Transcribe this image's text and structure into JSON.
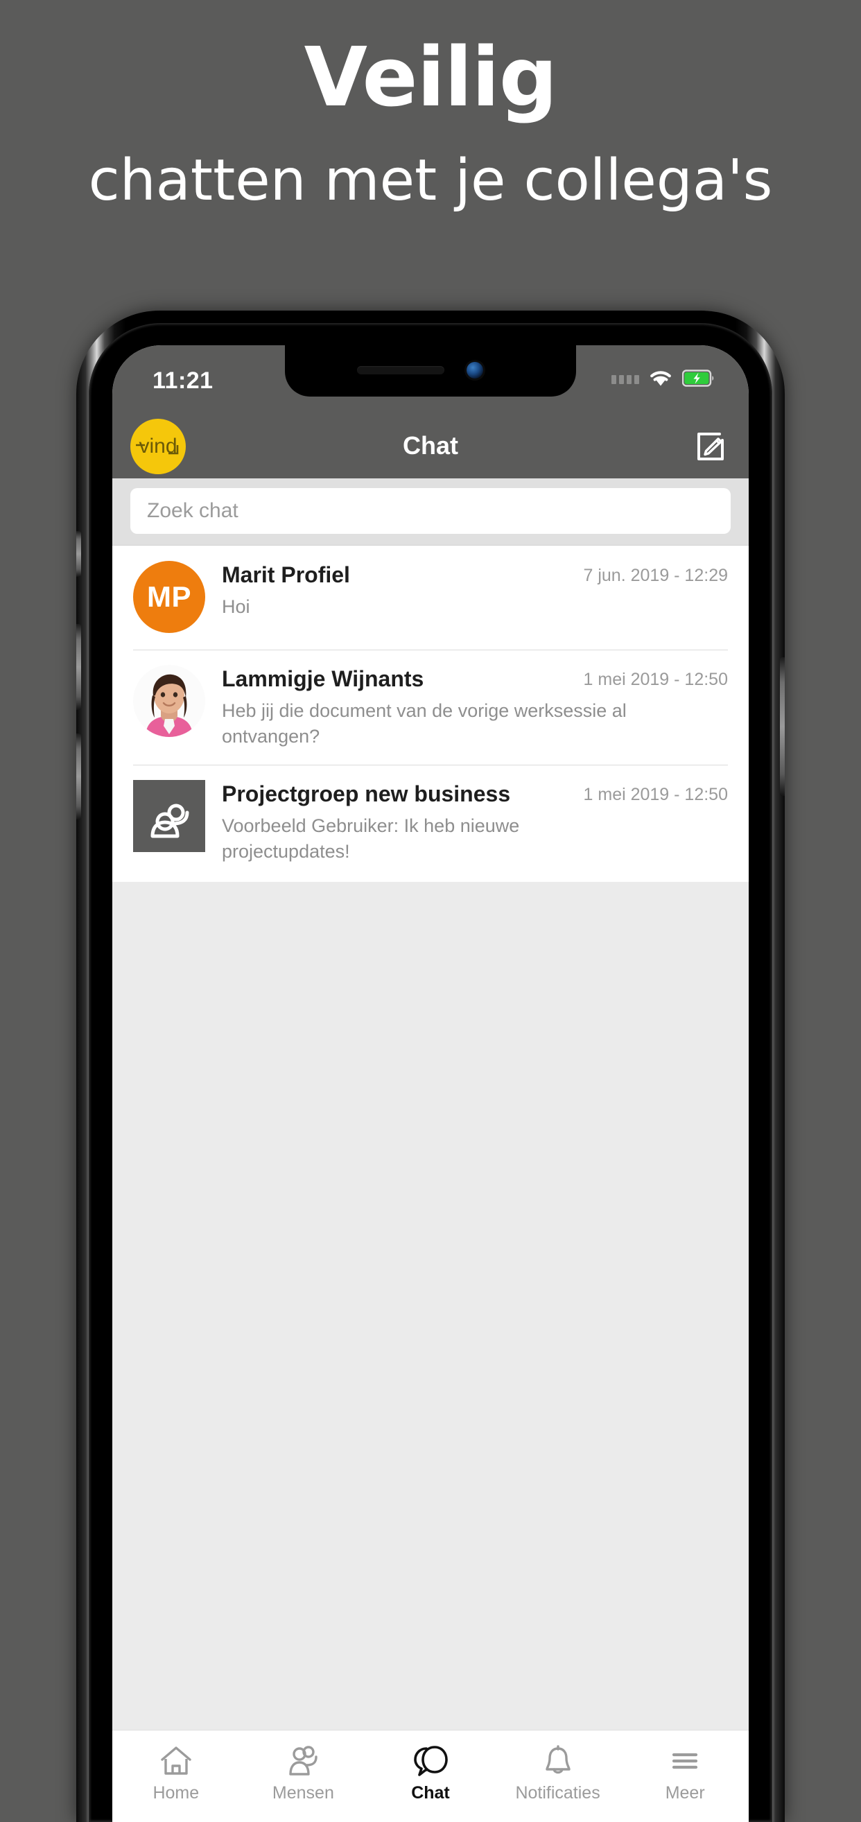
{
  "promo": {
    "headline": "Veilig",
    "subheadline": "chatten met je collega's",
    "background_color": "#5b5b5a",
    "text_color": "#ffffff"
  },
  "device": {
    "status_bar": {
      "time": "11:21",
      "signal_icon": "signal-bars-icon",
      "wifi_icon": "wifi-icon",
      "battery_icon": "battery-charging-icon",
      "battery_color": "#32cd32"
    },
    "nav_bar": {
      "logo_text": "vind",
      "logo_color": "#f5c70b",
      "title": "Chat",
      "compose_icon": "compose-pencil-icon",
      "background_color": "#5b5b5a"
    },
    "search": {
      "placeholder": "Zoek chat",
      "value": ""
    },
    "chats": [
      {
        "name": "Marit Profiel",
        "preview": "Hoi",
        "timestamp": "7 jun. 2019 - 12:29",
        "avatar_type": "initials",
        "avatar_initials": "MP",
        "avatar_color": "#ee7d0e"
      },
      {
        "name": "Lammigje Wijnants",
        "preview": "Heb jij die document van de vorige werksessie al ontvangen?",
        "timestamp": "1 mei 2019 - 12:50",
        "avatar_type": "photo",
        "avatar_initials": "",
        "avatar_color": "#fdfdfd"
      },
      {
        "name": "Projectgroep new business",
        "preview": "Voorbeeld Gebruiker: Ik heb nieuwe projectupdates!",
        "timestamp": "1 mei 2019 - 12:50",
        "avatar_type": "group",
        "avatar_initials": "",
        "avatar_color": "#5b5b5a"
      }
    ],
    "tabs": [
      {
        "label": "Home",
        "icon": "home-icon",
        "active": false
      },
      {
        "label": "Mensen",
        "icon": "people-icon",
        "active": false
      },
      {
        "label": "Chat",
        "icon": "chat-bubbles-icon",
        "active": true
      },
      {
        "label": "Notificaties",
        "icon": "bell-icon",
        "active": false
      },
      {
        "label": "Meer",
        "icon": "hamburger-menu-icon",
        "active": false
      }
    ]
  }
}
